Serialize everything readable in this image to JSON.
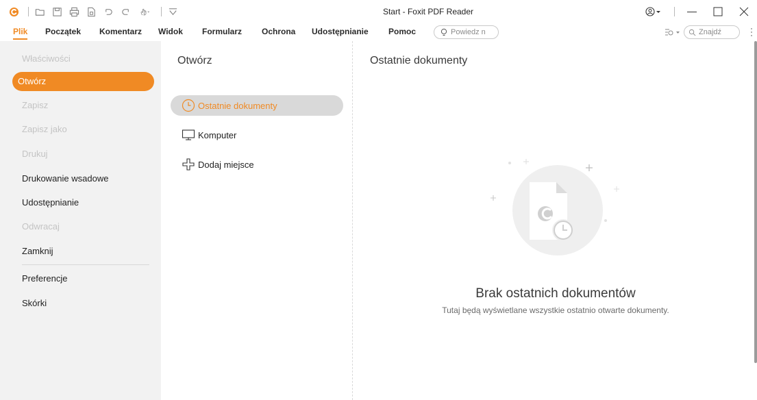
{
  "window": {
    "title": "Start - Foxit PDF Reader"
  },
  "colors": {
    "accent": "#f08a24",
    "sidebar_bg": "#f2f2f2",
    "selected_item_bg": "#d9d9d9",
    "disabled_text": "#c4c4c4"
  },
  "quick_access": {
    "icons": [
      "foxit-logo-icon",
      "open-icon",
      "save-icon",
      "print-icon",
      "new-icon",
      "undo-icon",
      "redo-icon",
      "hand-tool-icon",
      "customize-icon"
    ]
  },
  "ribbon": {
    "tabs": [
      "Plik",
      "Początek",
      "Komentarz",
      "Widok",
      "Formularz",
      "Ochrona",
      "Udostępnianie",
      "Pomoc"
    ],
    "active_tab": "Plik",
    "tell_me_placeholder": "Powiedz n",
    "find_placeholder": "Znajdź"
  },
  "sidebar": {
    "items": [
      {
        "label": "Właściwości",
        "state": "disabled"
      },
      {
        "label": "Otwórz",
        "state": "selected"
      },
      {
        "label": "Zapisz",
        "state": "disabled"
      },
      {
        "label": "Zapisz jako",
        "state": "disabled"
      },
      {
        "label": "Drukuj",
        "state": "disabled"
      },
      {
        "label": "Drukowanie wsadowe",
        "state": "normal"
      },
      {
        "label": "Udostępnianie",
        "state": "normal"
      },
      {
        "label": "Odwracaj",
        "state": "disabled"
      },
      {
        "label": "Zamknij",
        "state": "normal"
      },
      {
        "label": "Preferencje",
        "state": "normal"
      },
      {
        "label": "Skórki",
        "state": "normal"
      }
    ]
  },
  "open_pane": {
    "title": "Otwórz",
    "items": [
      {
        "label": "Ostatnie dokumenty",
        "icon": "clock-icon",
        "selected": true
      },
      {
        "label": "Komputer",
        "icon": "monitor-icon",
        "selected": false
      },
      {
        "label": "Dodaj miejsce",
        "icon": "plus-icon",
        "selected": false
      }
    ]
  },
  "recent_pane": {
    "title": "Ostatnie dokumenty",
    "empty_title": "Brak ostatnich dokumentów",
    "empty_subtitle": "Tutaj będą wyświetlane wszystkie ostatnio otwarte dokumenty."
  }
}
